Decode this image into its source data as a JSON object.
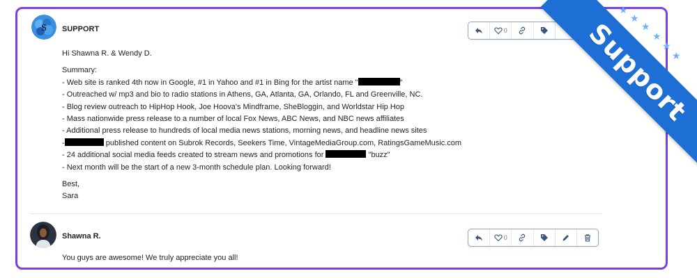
{
  "colors": {
    "frame": "#7b3fe0",
    "ribbon": "#1d6fd6",
    "action_icon": "#3a5578"
  },
  "ribbon": {
    "label": "Support"
  },
  "posts": [
    {
      "author": "SUPPORT",
      "greeting": "Hi Shawna R. & Wendy D.",
      "summary_label": "Summary:",
      "lines": [
        {
          "before": " - Web site is ranked 4th now in Google, #1 in Yahoo and #1 in Bing for the artist name \"",
          "redacted": true,
          "after": "\""
        },
        {
          "before": " - Outreached w/ mp3 and bio to radio stations in Athens, GA, Atlanta, GA, Orlando, FL and Greenville, NC.",
          "redacted": false,
          "after": ""
        },
        {
          "before": " - Blog review outreach to HipHop Hook, Joe Hoova's Mindframe, SheBloggin, and Worldstar Hip Hop",
          "redacted": false,
          "after": ""
        },
        {
          "before": " - Mass nationwide press release to a number of local Fox News, ABC News, and NBC news affiliates",
          "redacted": false,
          "after": ""
        },
        {
          "before": " - Additional press release to hundreds of local media news stations, morning news, and headline news sites",
          "redacted": false,
          "after": ""
        },
        {
          "before": " -",
          "redacted": true,
          "after": " published content on Subrok Records, Seekers Time, VintageMediaGroup.com, RatingsGameMusic.com"
        },
        {
          "before": " - 24 additional social media feeds created to stream news and promotions for ",
          "redacted": true,
          "after": " \"buzz\""
        },
        {
          "before": " - Next month will be the start of a new 3-month schedule plan.  Looking forward!",
          "redacted": false,
          "after": ""
        }
      ],
      "closing": "Best,",
      "signature": "Sara",
      "like_count": "0",
      "actions": [
        "reply-icon",
        "heart-icon",
        "link-icon",
        "tag-icon"
      ]
    },
    {
      "author": "Shawna R.",
      "message": "You guys are awesome! We truly appreciate you all!",
      "like_count": "0",
      "actions": [
        "reply-icon",
        "heart-icon",
        "link-icon",
        "tag-icon",
        "edit-icon",
        "trash-icon"
      ]
    }
  ]
}
